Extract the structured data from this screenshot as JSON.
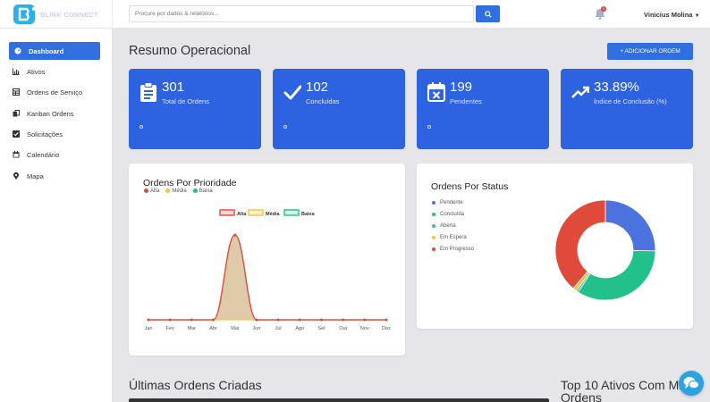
{
  "brand": {
    "name": "BLINK CONNECT"
  },
  "search": {
    "placeholder": "Procure por dados & relatórios..."
  },
  "notifications": {
    "count": "0"
  },
  "user": {
    "name": "Vinicius Molina"
  },
  "sidebar": {
    "items": [
      {
        "label": "Dashboard",
        "icon": "dashboard-icon"
      },
      {
        "label": "Ativos",
        "icon": "bar-chart-icon"
      },
      {
        "label": "Ordens de Serviço",
        "icon": "table-icon"
      },
      {
        "label": "Kanban Ordens",
        "icon": "copy-icon"
      },
      {
        "label": "Solicitações",
        "icon": "checkbox-icon"
      },
      {
        "label": "Calendário",
        "icon": "calendar-icon"
      },
      {
        "label": "Mapa",
        "icon": "map-pin-icon"
      }
    ]
  },
  "main": {
    "title": "Resumo Operacional",
    "add_button": "+ ADICIONAR ORDEM",
    "stats": [
      {
        "value": "301",
        "label": "Total de Ordens",
        "icon": "clipboard-icon"
      },
      {
        "value": "102",
        "label": "Concluídas",
        "icon": "check-icon"
      },
      {
        "value": "199",
        "label": "Pendentes",
        "icon": "calendar-x-icon"
      },
      {
        "value": "33.89%",
        "label": "Índice de Conclusão (%)",
        "icon": "trending-up-icon"
      }
    ],
    "priority_card": {
      "title": "Ordens Por Prioridade",
      "legend": [
        "Alta",
        "Média",
        "Baixa"
      ]
    },
    "status_card": {
      "title": "Ordens Por Status",
      "legend": [
        "Pendente",
        "Concluída",
        "Aberta",
        "Em Espera",
        "Em Progresso"
      ]
    },
    "latest_title": "Últimas Ordens Criadas",
    "top_assets_title_line1": "Top 10 Ativos Com Mais",
    "top_assets_title_line2": "Ordens"
  },
  "colors": {
    "primary": "#2f6fe0",
    "card_blue": "#2d62e0",
    "alta": "#e04a3a",
    "media": "#f4c242",
    "baixa": "#22c08a"
  },
  "chart_data": [
    {
      "type": "area",
      "title": "Ordens Por Prioridade",
      "categories": [
        "Jan",
        "Fev",
        "Mar",
        "Abr",
        "Mai",
        "Jun",
        "Jul",
        "Ago",
        "Set",
        "Out",
        "Nov",
        "Dez"
      ],
      "series": [
        {
          "name": "Alta",
          "color": "#e04a3a",
          "values": [
            0,
            0,
            0,
            0,
            301,
            0,
            0,
            0,
            0,
            0,
            0,
            0
          ]
        },
        {
          "name": "Média",
          "color": "#f4c242",
          "values": [
            0,
            0,
            0,
            0,
            0,
            0,
            0,
            0,
            0,
            0,
            0,
            0
          ]
        },
        {
          "name": "Baixa",
          "color": "#22c08a",
          "values": [
            0,
            0,
            0,
            0,
            0,
            0,
            0,
            0,
            0,
            0,
            0,
            0
          ]
        }
      ],
      "legend_labels": [
        "Alta",
        "Média",
        "Baixa"
      ],
      "ylim": [
        0,
        301
      ]
    },
    {
      "type": "pie",
      "title": "Ordens Por Status",
      "series": [
        {
          "name": "Pendente",
          "value": 76,
          "color": "#4c72de"
        },
        {
          "name": "Concluída",
          "value": 102,
          "color": "#22c08a"
        },
        {
          "name": "Aberta",
          "value": 2,
          "color": "#39b6c8"
        },
        {
          "name": "Em Espera",
          "value": 4,
          "color": "#f4c242"
        },
        {
          "name": "Em Progresso",
          "value": 117,
          "color": "#e04a3a"
        }
      ]
    }
  ]
}
